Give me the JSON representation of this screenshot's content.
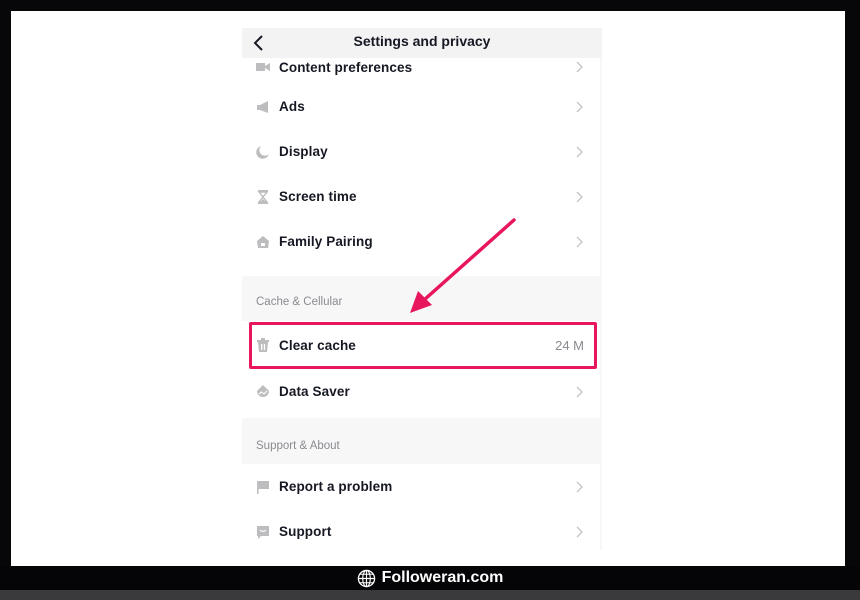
{
  "header": {
    "title": "Settings and privacy",
    "back_icon": "chevron-left-icon"
  },
  "groups": [
    {
      "items": [
        {
          "label": "Content preferences",
          "icon": "video-camera-icon"
        },
        {
          "label": "Ads",
          "icon": "megaphone-icon"
        },
        {
          "label": "Display",
          "icon": "moon-icon"
        },
        {
          "label": "Screen time",
          "icon": "hourglass-icon"
        },
        {
          "label": "Family Pairing",
          "icon": "house-icon"
        }
      ]
    },
    {
      "title": "Cache & Cellular",
      "items": [
        {
          "label": "Clear cache",
          "icon": "trash-icon",
          "value": "24 M",
          "highlighted": true
        },
        {
          "label": "Data Saver",
          "icon": "data-saver-icon"
        }
      ]
    },
    {
      "title": "Support & About",
      "items": [
        {
          "label": "Report a problem",
          "icon": "flag-icon"
        },
        {
          "label": "Support",
          "icon": "chat-bubble-icon"
        }
      ]
    }
  ],
  "annotation": {
    "color": "#e8175d",
    "target": "Clear cache"
  },
  "watermark": {
    "text": "Followeran.com",
    "icon": "globe-icon"
  }
}
